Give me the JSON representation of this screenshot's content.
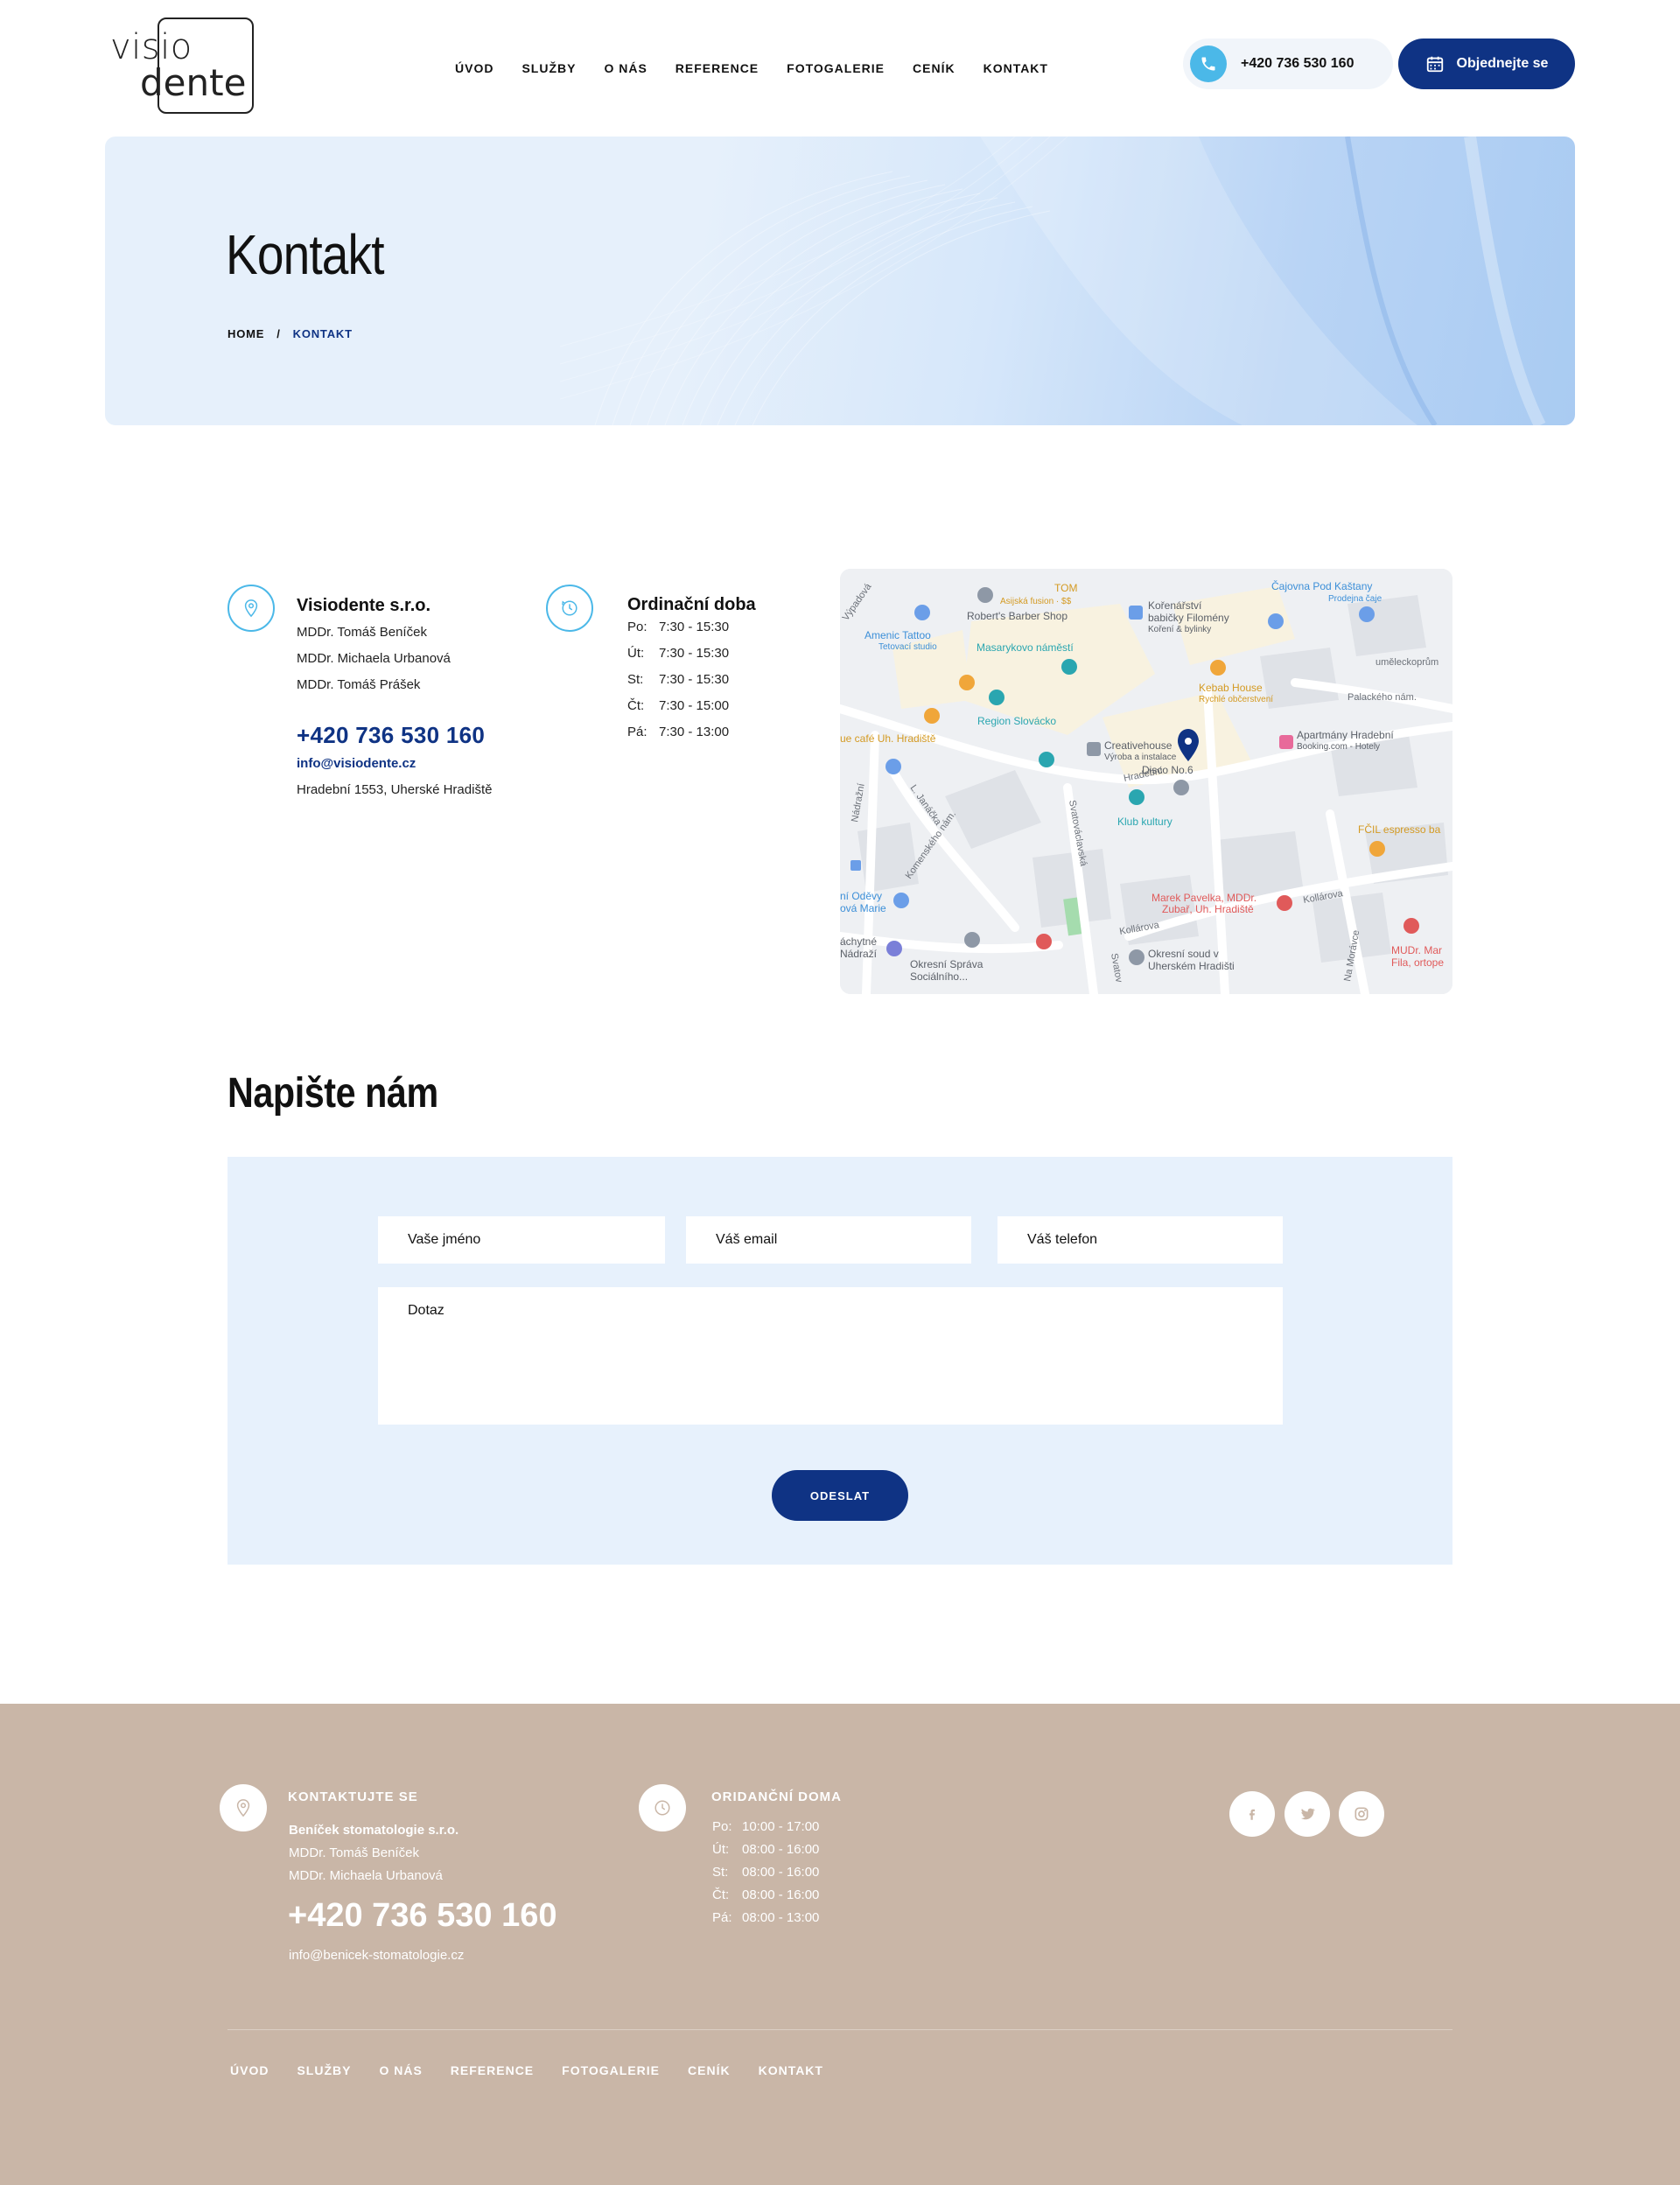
{
  "header": {
    "logo_top": "visio",
    "logo_bottom": "dente",
    "nav": [
      "ÚVOD",
      "SLUŽBY",
      "O NÁS",
      "REFERENCE",
      "FOTOGALERIE",
      "CENÍK",
      "KONTAKT"
    ],
    "phone": "+420 736 530 160",
    "book_label": "Objednejte se"
  },
  "hero": {
    "title": "Kontakt",
    "breadcrumb": {
      "home": "HOME",
      "separator": "/",
      "current": "KONTAKT"
    }
  },
  "contact": {
    "company": "Visiodente s.r.o.",
    "people": [
      "MDDr. Tomáš Beníček",
      "MDDr. Michaela Urbanová",
      "MDDr. Tomáš Prášek"
    ],
    "phone": "+420 736 530 160",
    "email": "info@visiodente.cz",
    "address": "Hradební 1553, Uherské Hradiště"
  },
  "hours": {
    "title": "Ordinační doba",
    "rows": [
      {
        "day": "Po:",
        "time": "7:30 - 15:30"
      },
      {
        "day": "Út:",
        "time": "7:30 - 15:30"
      },
      {
        "day": "St:",
        "time": "7:30 - 15:30"
      },
      {
        "day": "Čt:",
        "time": "7:30 - 15:00"
      },
      {
        "day": "Pá:",
        "time": "7:30 - 13:00"
      }
    ]
  },
  "map": {
    "labels": {
      "tom": "TOM",
      "tom_sub": "Asijská fusion · $$",
      "barber": "Robert's Barber Shop",
      "korenarstvi": "Kořenářství",
      "korenarstvi2": "babičky Filomény",
      "korenarstvi_sub": "Koření & bylinky",
      "cajovna": "Čajovna Pod Kaštany",
      "cajovna_sub": "Prodejna čaje",
      "amenic": "Amenic Tattoo",
      "amenic_sub": "Tetovací studio",
      "masarykovo": "Masarykovo náměstí",
      "umelecko": "uměleckoprům",
      "kebab": "Kebab House",
      "kebab_sub": "Rychlé občerstvení",
      "palackeho": "Palackého nám.",
      "region": "Region Slovácko",
      "cafe": "ue café Uh. Hradiště",
      "creativehouse": "Creativehouse",
      "creativehouse_sub": "Výroba a instalace",
      "apartmany": "Apartmány Hradební",
      "apartmany_sub": "Booking.com - Hotely",
      "disco": "Disco No.6",
      "hradebni": "Hradební",
      "klub": "Klub kultury",
      "fcil": "FČIL espresso ba",
      "svatovaclavska": "Svatováclavská",
      "vypadova": "Výpadová",
      "nadrazni": "Nádražní",
      "jana": "L. Janáčka",
      "komenskeho": "Komenského nám.",
      "oděvy": "ní Oděvy",
      "oděvy2": "ová Marie",
      "marek": "Marek Pavelka, MDDr.",
      "marek2": "Zubař, Uh. Hradiště",
      "kollarova": "Kollárova",
      "kollarova2": "Kollárova",
      "mudr": "MUDr. Mar",
      "mudr2": "Fila, ortope",
      "nachytne": "áchytné",
      "nadrazi": "Nádraží",
      "okresni_sprava": "Okresní Správa",
      "okresni_sprava2": "Sociálního...",
      "okresni_soud": "Okresní soud v",
      "okresni_soud2": "Uherském Hradišti",
      "na_moravce": "Na Morávce",
      "svatov2": "Svatov"
    }
  },
  "form": {
    "title": "Napište nám",
    "name_placeholder": "Vaše jméno",
    "email_placeholder": "Váš email",
    "phone_placeholder": "Váš telefon",
    "message_placeholder": "Dotaz",
    "submit": "ODESLAT"
  },
  "footer": {
    "contact_head": "KONTAKTUJTE SE",
    "company": "Beníček stomatologie s.r.o.",
    "people": [
      "MDDr. Tomáš Beníček",
      "MDDr. Michaela Urbanová"
    ],
    "phone": "+420 736 530 160",
    "email": "info@benicek-stomatologie.cz",
    "hours_head": "ORIDANČNÍ DOMA",
    "hours": [
      {
        "day": "Po:",
        "time": "10:00 - 17:00"
      },
      {
        "day": "Út:",
        "time": "08:00 - 16:00"
      },
      {
        "day": "St:",
        "time": "08:00 - 16:00"
      },
      {
        "day": "Čt:",
        "time": "08:00 - 16:00"
      },
      {
        "day": "Pá:",
        "time": "08:00 - 13:00"
      }
    ],
    "nav": [
      "ÚVOD",
      "SLUŽBY",
      "O NÁS",
      "REFERENCE",
      "FOTOGALERIE",
      "CENÍK",
      "KONTAKT"
    ]
  },
  "colors": {
    "primary": "#0f3384",
    "accent": "#4bb8e8",
    "footer_bg": "#c9b6a7",
    "form_bg": "#e7f1fc"
  }
}
